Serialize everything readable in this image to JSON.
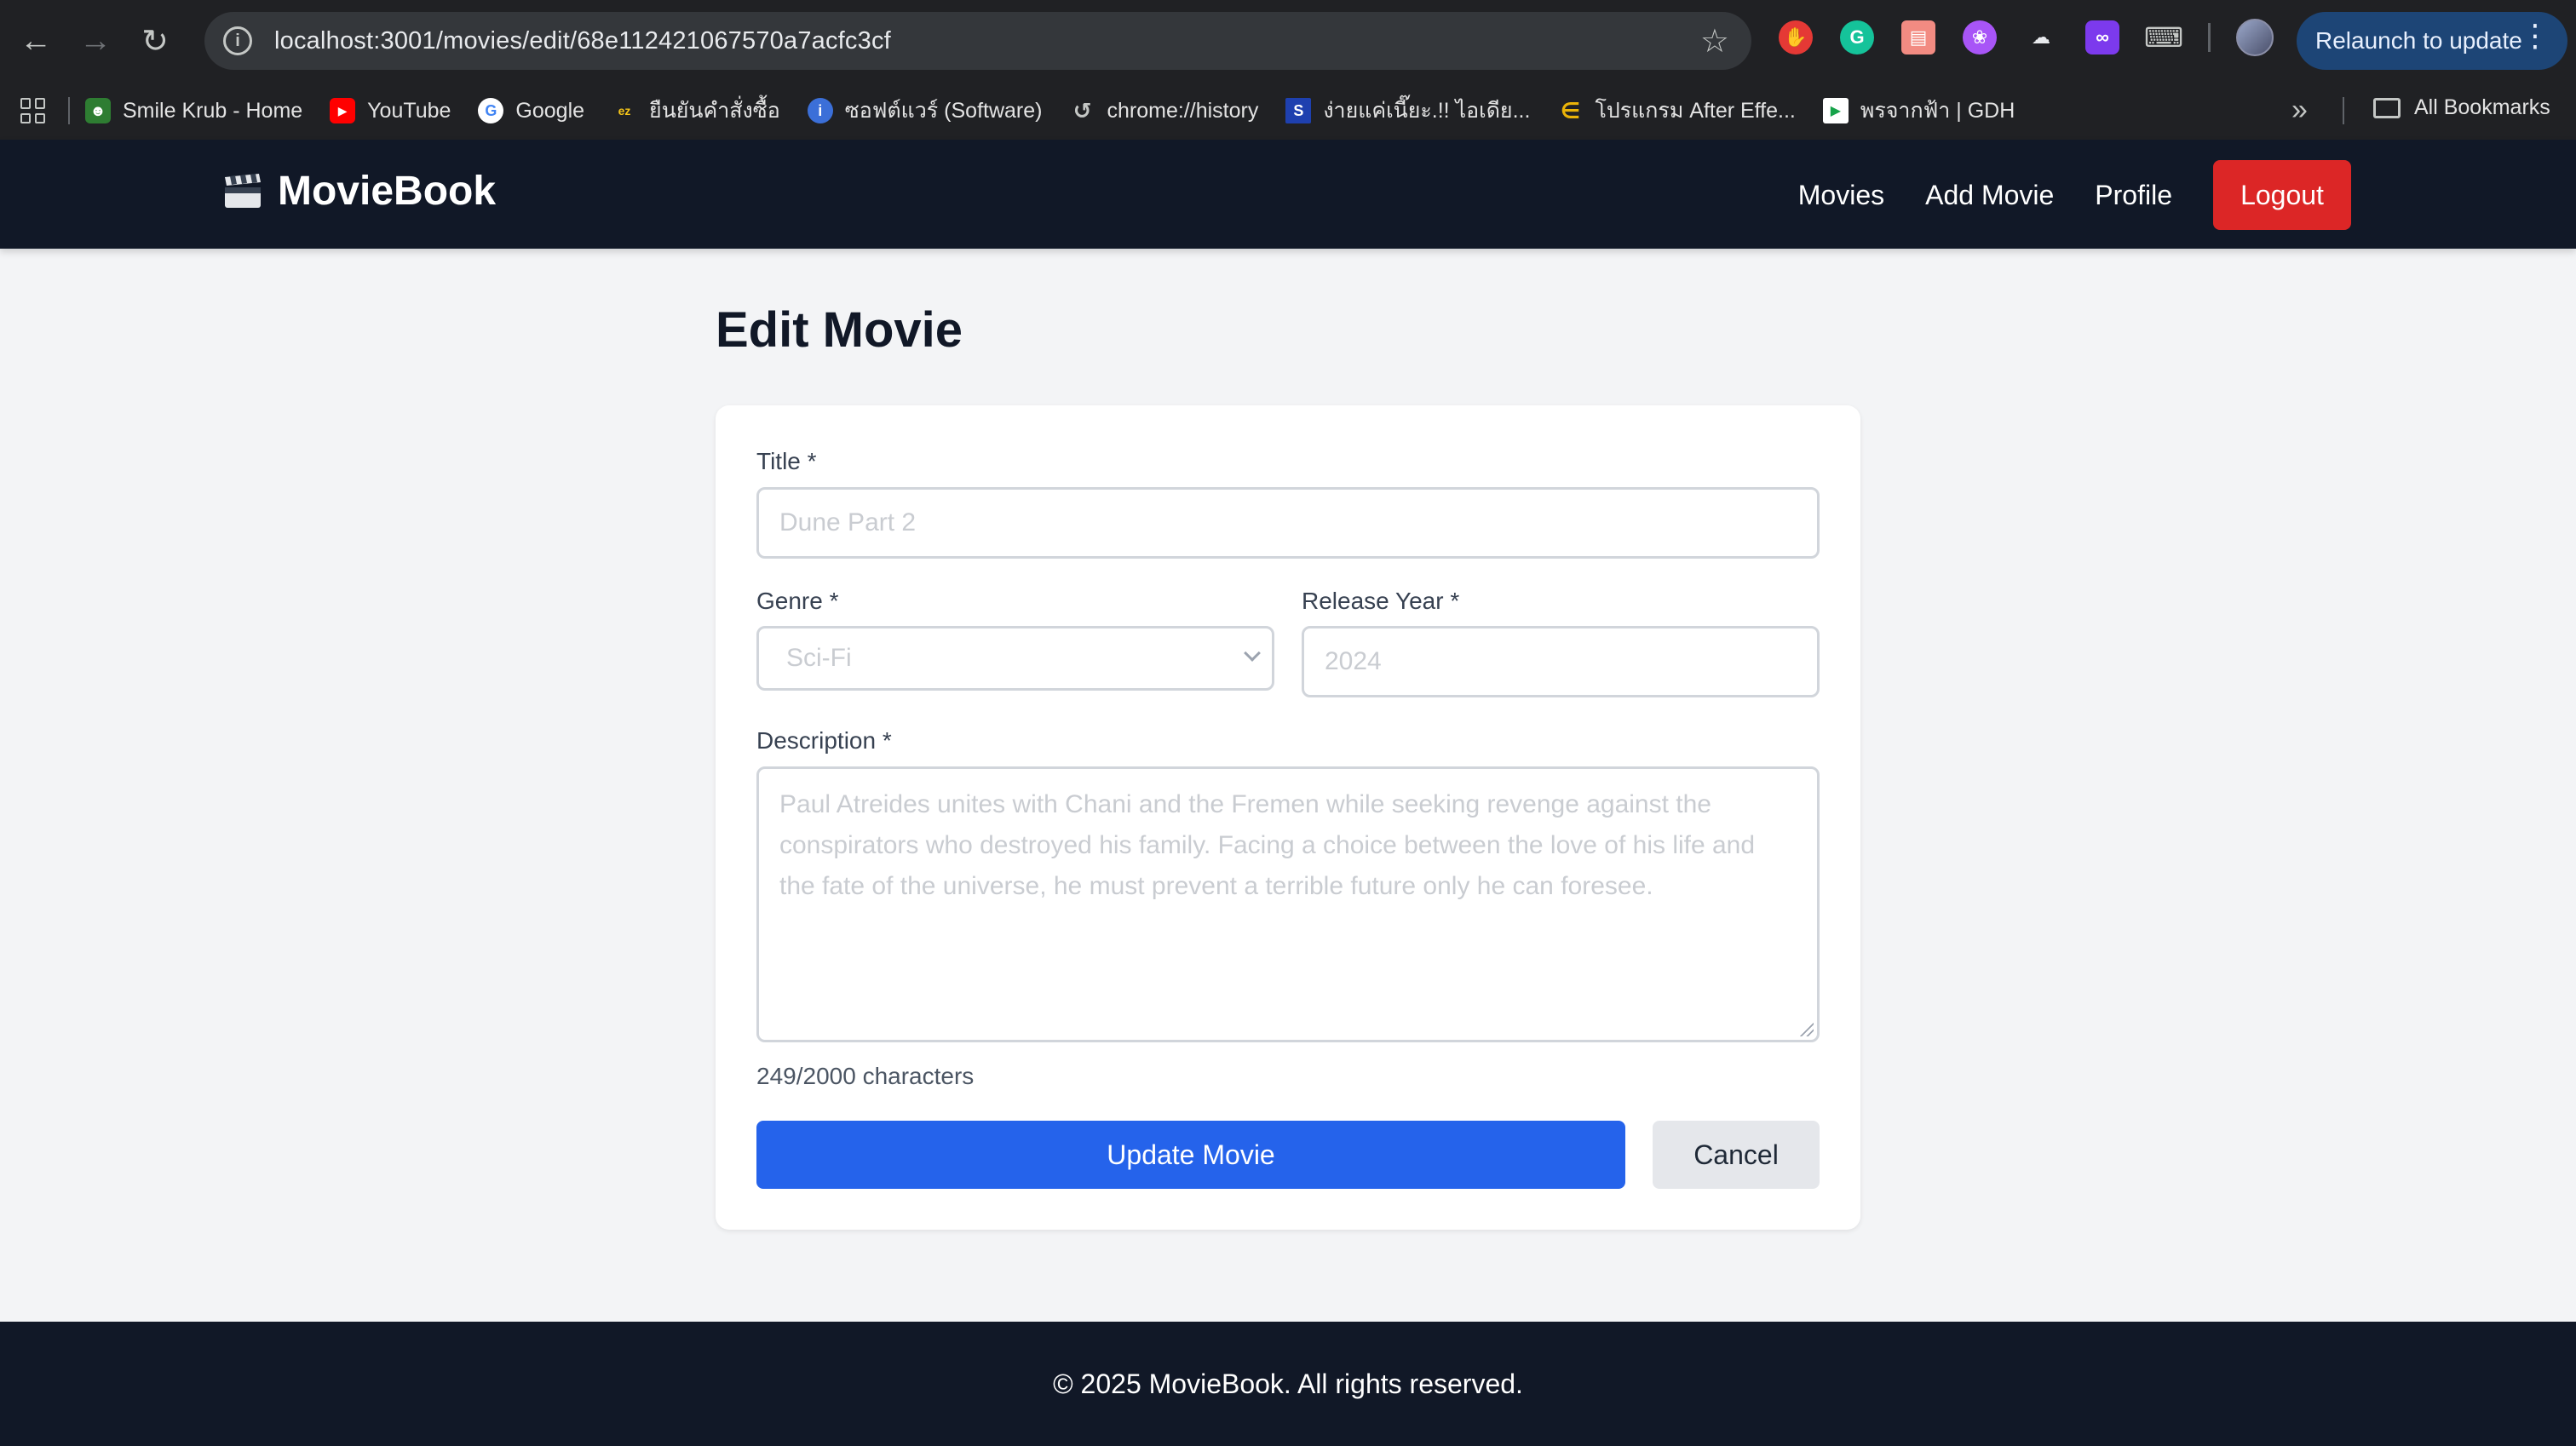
{
  "browser": {
    "url": "localhost:3001/movies/edit/68e112421067570a7acfc3cf",
    "relaunch_label": "Relaunch to update",
    "bookmarks": [
      {
        "label": "Smile Krub - Home",
        "icon": "smile-krub-icon",
        "color": "#2e7d32"
      },
      {
        "label": "YouTube",
        "icon": "youtube-icon",
        "color": "#ff0000"
      },
      {
        "label": "Google",
        "icon": "google-icon",
        "color": "#4285f4"
      },
      {
        "label": "ยืนยันคำสั่งซื้อ",
        "icon": "ez-icon",
        "color": "#f5c518"
      },
      {
        "label": "ซอฟต์แวร์ (Software)",
        "icon": "info-icon",
        "color": "#3b6fd8"
      },
      {
        "label": "chrome://history",
        "icon": "history-icon",
        "color": "#5f6368"
      },
      {
        "label": "ง่ายแค่เนี๊ยะ.!! ไอเดีย...",
        "icon": "s-site-icon",
        "color": "#1e40af"
      },
      {
        "label": "โปรแกรม After Effe...",
        "icon": "e-site-icon",
        "color": "#eab308"
      },
      {
        "label": "พรจากฟ้า | GDH",
        "icon": "gdh-play-icon",
        "color": "#16a34a"
      }
    ],
    "all_bookmarks_label": "All Bookmarks"
  },
  "header": {
    "brand": "MovieBook",
    "nav": {
      "movies": "Movies",
      "add_movie": "Add Movie",
      "profile": "Profile",
      "logout": "Logout"
    },
    "colors": {
      "bg": "#111827",
      "logout": "#dc2626"
    }
  },
  "page": {
    "title": "Edit Movie"
  },
  "form": {
    "title_label": "Title *",
    "title_placeholder": "Dune Part 2",
    "genre_label": "Genre *",
    "genre_selected": "Sci-Fi",
    "year_label": "Release Year *",
    "year_placeholder": "2024",
    "description_label": "Description *",
    "description_placeholder": "Paul Atreides unites with Chani and the Fremen while seeking revenge against the conspirators who destroyed his family. Facing a choice between the love of his life and the fate of the universe, he must prevent a terrible future only he can foresee.",
    "char_count": "249/2000 characters",
    "update_button": "Update Movie",
    "cancel_button": "Cancel",
    "colors": {
      "primary": "#2563eb",
      "secondary": "#e5e7eb"
    }
  },
  "footer": {
    "text": "© 2025 MovieBook. All rights reserved."
  }
}
